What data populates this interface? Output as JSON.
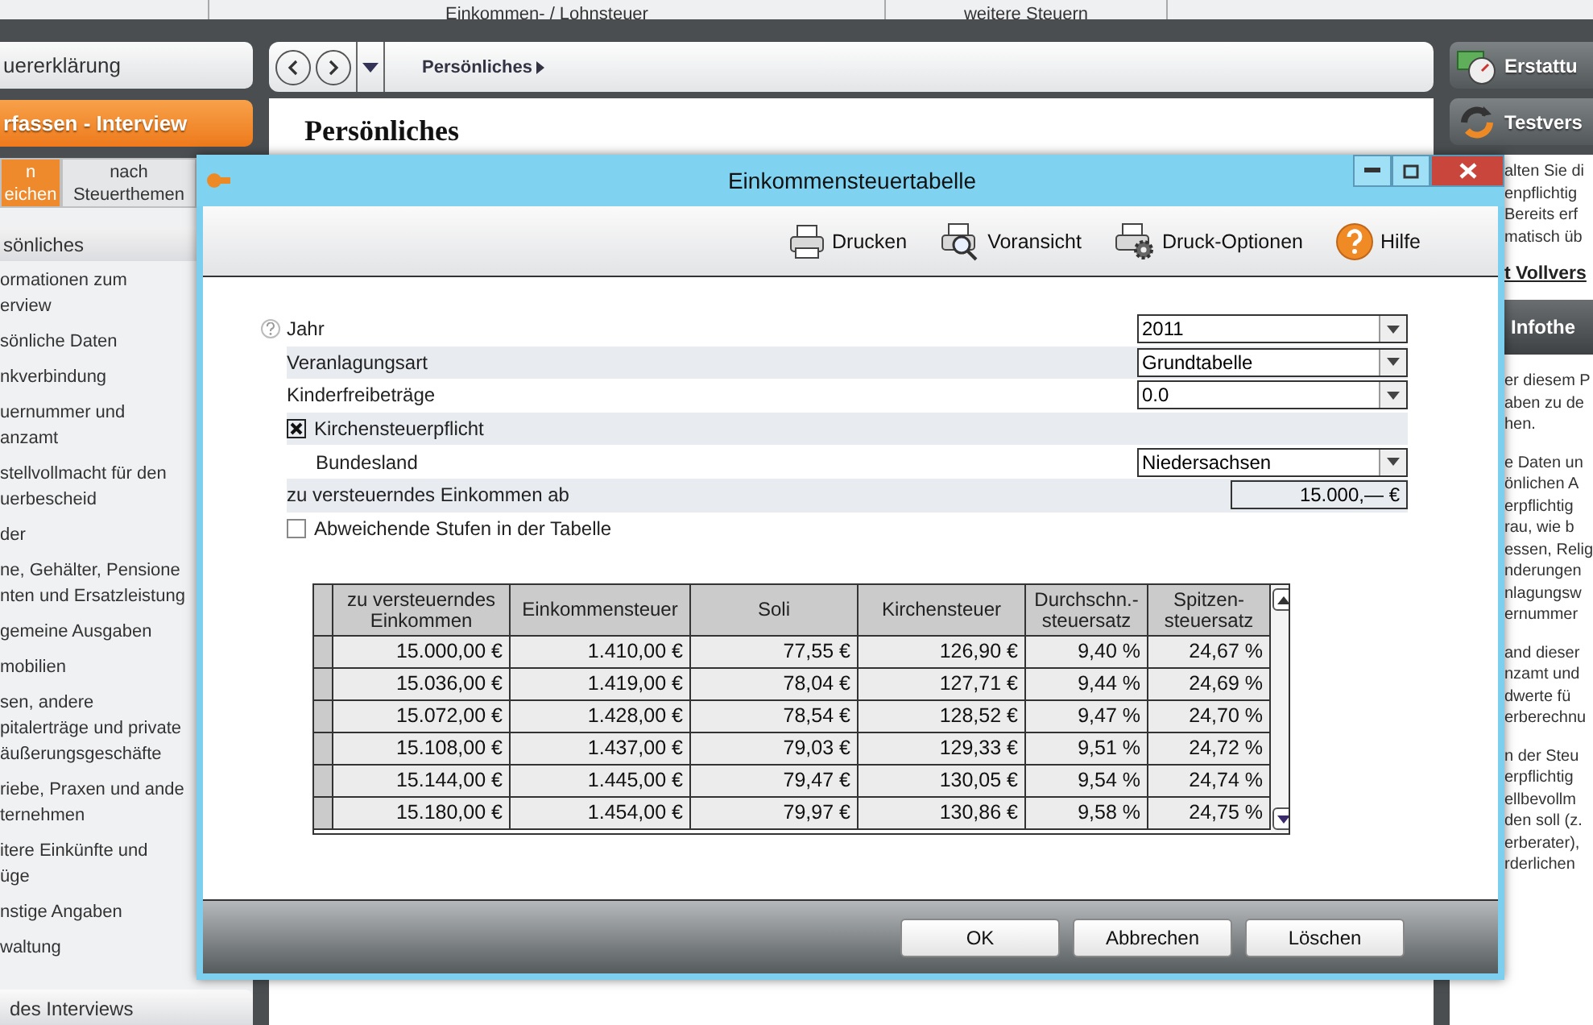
{
  "top_tabs": [
    "Einkommen- / Lohnsteuer",
    "weitere Steuern"
  ],
  "sidebar": {
    "buttons": [
      {
        "label": "uererklärung",
        "selected": false
      },
      {
        "label": "rfassen - Interview",
        "selected": true
      }
    ],
    "view_tabs": [
      {
        "lines": [
          "n",
          "eichen"
        ],
        "selected": true
      },
      {
        "lines": [
          "nach",
          "Steuerthemen"
        ],
        "selected": false
      }
    ],
    "section": "sönliches",
    "items": [
      {
        "lines": [
          "ormationen zum",
          "erview"
        ]
      },
      {
        "lines": [
          "sönliche Daten"
        ]
      },
      {
        "lines": [
          "nkverbindung"
        ]
      },
      {
        "lines": [
          "uernummer und",
          "anzamt"
        ]
      },
      {
        "lines": [
          "stellvollmacht für den",
          "uerbescheid"
        ]
      },
      {
        "lines": [
          "der"
        ]
      },
      {
        "lines": [
          "ne, Gehälter, Pensione",
          "nten und Ersatzleistung"
        ]
      },
      {
        "lines": [
          "gemeine Ausgaben"
        ]
      },
      {
        "lines": [
          "mobilien"
        ]
      },
      {
        "lines": [
          "sen, andere",
          "pitalerträge und private",
          "äußerungsgeschäfte"
        ]
      },
      {
        "lines": [
          "riebe, Praxen und ande",
          "ternehmen"
        ]
      },
      {
        "lines": [
          "itere Einkünfte und",
          "üge"
        ]
      },
      {
        "lines": [
          "nstige Angaben"
        ]
      },
      {
        "lines": [
          "waltung"
        ]
      }
    ],
    "footer": "des Interviews"
  },
  "nav": {
    "breadcrumb": "Persönliches",
    "heading": "Persönliches"
  },
  "right": {
    "buttons": [
      {
        "label": "Erstattu",
        "kind": "gauge"
      },
      {
        "label": "Testvers",
        "kind": "refresh"
      }
    ],
    "promo": [
      "alten Sie di",
      "enpflichtig",
      "Bereits erf",
      "matisch üb"
    ],
    "link": "t Vollvers",
    "info_title": "Infothe",
    "paragraphs": [
      [
        "er diesem P",
        "aben zu de",
        "hen."
      ],
      [
        "e Daten un",
        "önlichen A",
        "erpflichtig",
        "rau, wie b",
        "essen, Relig",
        "nderungen",
        "nlagungsw",
        "ernummer"
      ],
      [
        "and dieser",
        "nzamt und",
        "dwerte fü",
        "erberechnu"
      ],
      [
        "n der Steu",
        "erpflichtig",
        "ellbevollm",
        "den soll (z.",
        "erberater),",
        "rderlichen"
      ]
    ]
  },
  "dialog": {
    "title": "Einkommensteuertabelle",
    "toolbar": [
      {
        "label": "Drucken",
        "kind": "print"
      },
      {
        "label": "Voransicht",
        "kind": "preview"
      },
      {
        "label": "Druck-Optionen",
        "kind": "options"
      },
      {
        "label": "Hilfe",
        "kind": "help"
      }
    ],
    "form": [
      {
        "kind": "select",
        "label": "Jahr",
        "value": "2011",
        "help": true
      },
      {
        "kind": "select",
        "label": "Veranlagungsart",
        "value": "Grundtabelle"
      },
      {
        "kind": "select",
        "label": "Kinderfreibeträge",
        "value": "0.0"
      },
      {
        "kind": "checkbox",
        "label": "Kirchensteuerpflicht",
        "checked": true
      },
      {
        "kind": "select",
        "label": "Bundesland",
        "value": "Niedersachsen",
        "indent": true
      },
      {
        "kind": "input",
        "label": "zu versteuerndes Einkommen ab",
        "value": "15.000,— €"
      },
      {
        "kind": "checkbox",
        "label": "Abweichende Stufen in der Tabelle",
        "checked": false
      }
    ],
    "table": {
      "columns": [
        "zu versteuerndes\nEinkommen",
        "Einkommensteuer",
        "Soli",
        "Kirchensteuer",
        "Durchschn.-\nsteuersatz",
        "Spitzen-\nsteuersatz"
      ],
      "rows": [
        [
          "15.000,00 €",
          "1.410,00 €",
          "77,55 €",
          "126,90 €",
          "9,40 %",
          "24,67 %"
        ],
        [
          "15.036,00 €",
          "1.419,00 €",
          "78,04 €",
          "127,71 €",
          "9,44 %",
          "24,69 %"
        ],
        [
          "15.072,00 €",
          "1.428,00 €",
          "78,54 €",
          "128,52 €",
          "9,47 %",
          "24,70 %"
        ],
        [
          "15.108,00 €",
          "1.437,00 €",
          "79,03 €",
          "129,33 €",
          "9,51 %",
          "24,72 %"
        ],
        [
          "15.144,00 €",
          "1.445,00 €",
          "79,47 €",
          "130,05 €",
          "9,54 %",
          "24,74 %"
        ],
        [
          "15.180,00 €",
          "1.454,00 €",
          "79,97 €",
          "130,86 €",
          "9,58 %",
          "24,75 %"
        ]
      ]
    },
    "buttons": [
      "OK",
      "Abbrechen",
      "Löschen"
    ]
  }
}
